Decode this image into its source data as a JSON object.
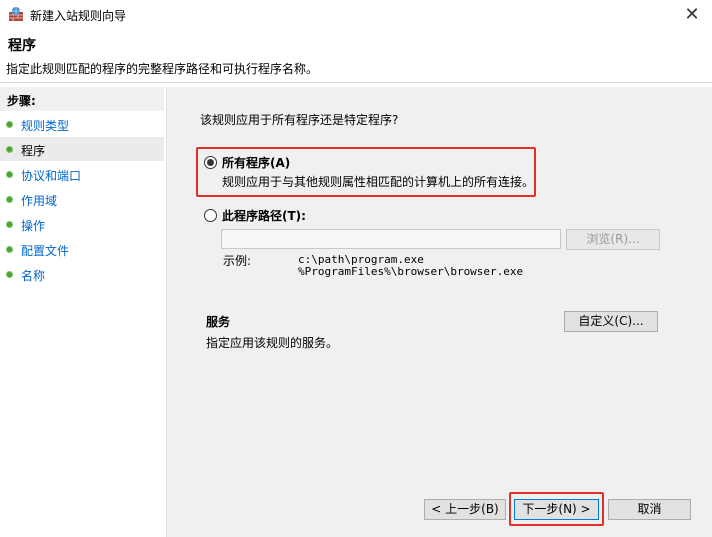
{
  "window": {
    "title": "新建入站规则向导",
    "close_glyph": "✕"
  },
  "header": {
    "title": "程序",
    "subtitle": "指定此规则匹配的程序的完整程序路径和可执行程序名称。"
  },
  "sidebar": {
    "steps_label": "步骤:",
    "items": [
      {
        "label": "规则类型"
      },
      {
        "label": "程序"
      },
      {
        "label": "协议和端口"
      },
      {
        "label": "作用域"
      },
      {
        "label": "操作"
      },
      {
        "label": "配置文件"
      },
      {
        "label": "名称"
      }
    ],
    "current_index": 1
  },
  "main": {
    "question": "该规则应用于所有程序还是特定程序?",
    "option_all": {
      "label": "所有程序(A)",
      "description": "规则应用于与其他规则属性相匹配的计算机上的所有连接。",
      "checked": true
    },
    "option_path": {
      "label": "此程序路径(T):",
      "checked": false,
      "value": "",
      "browse_label": "浏览(R)..."
    },
    "example_label": "示例:",
    "example_lines": [
      "c:\\path\\program.exe",
      "%ProgramFiles%\\browser\\browser.exe"
    ],
    "services": {
      "title": "服务",
      "description": "指定应用该规则的服务。",
      "customize_label": "自定义(C)..."
    }
  },
  "footer": {
    "back_label": "< 上一步(B)",
    "next_label": "下一步(N) >",
    "cancel_label": "取消"
  },
  "colors": {
    "highlight": "#e0302a",
    "link": "#0066cc",
    "step_dot": "#48a42e",
    "content_bg": "#f0f0f0"
  }
}
